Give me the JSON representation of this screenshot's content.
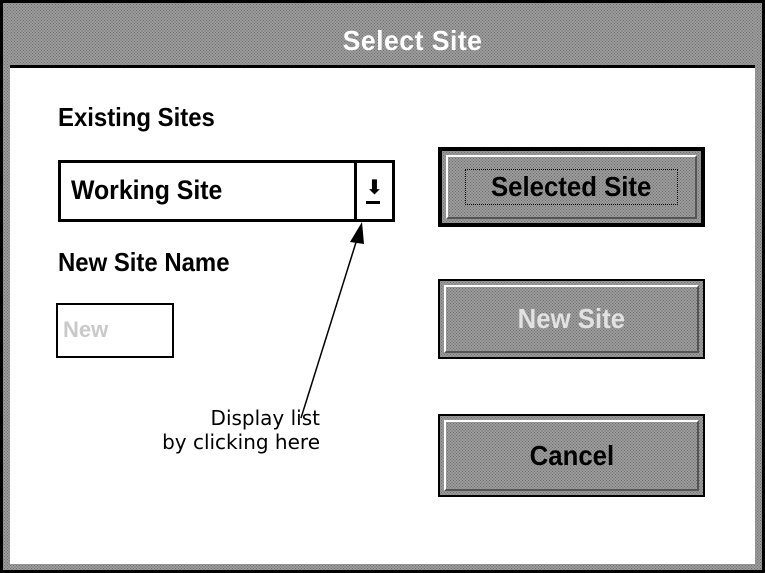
{
  "window": {
    "title": "Select Site"
  },
  "existing_sites": {
    "label": "Existing Sites",
    "selected_value": "Working Site",
    "dropdown_icon": "down-arrow-icon"
  },
  "new_site_name": {
    "label": "New Site Name",
    "value": "New"
  },
  "buttons": {
    "selected_site": "Selected Site",
    "new_site": "New Site",
    "cancel": "Cancel"
  },
  "annotation": {
    "line1": "Display list",
    "line2": "by clicking here"
  },
  "colors": {
    "dither_base": "#a6a6a6",
    "disabled_text": "#e2e2e2",
    "placeholder_text": "#c9c9c9"
  }
}
